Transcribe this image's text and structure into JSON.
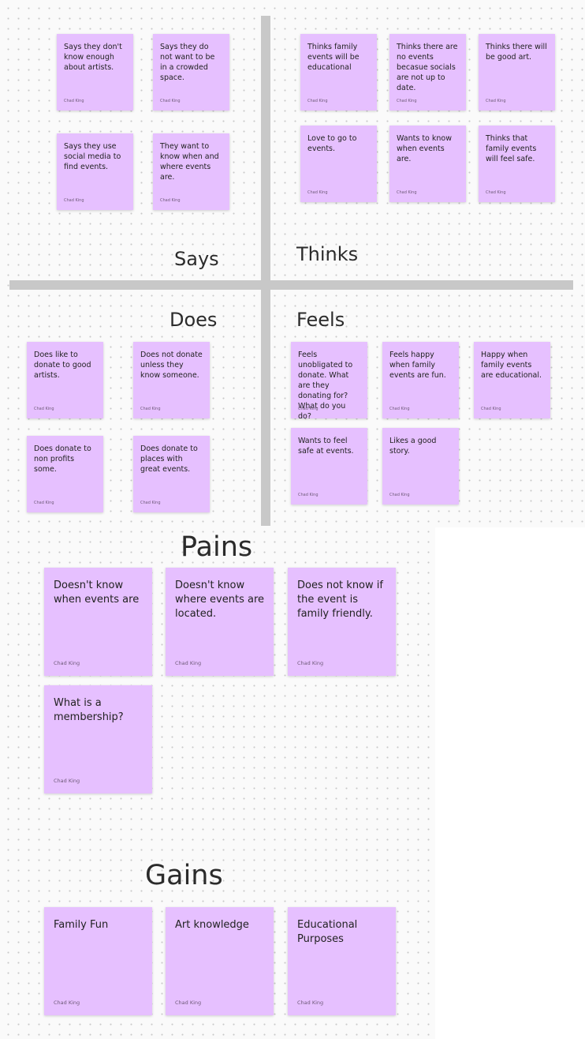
{
  "empathy_map": {
    "says": {
      "label": "Says",
      "notes": [
        {
          "text": "Says they don't know enough about artists.",
          "author": "Chad King"
        },
        {
          "text": "Says they do not want to be in a crowded space.",
          "author": "Chad King"
        },
        {
          "text": "Says they use social media to find events.",
          "author": "Chad King"
        },
        {
          "text": "They want to know when and where events are.",
          "author": "Chad King"
        }
      ]
    },
    "thinks": {
      "label": "Thinks",
      "notes": [
        {
          "text": "Thinks family events will be educational",
          "author": "Chad King"
        },
        {
          "text": "Thinks there are no events becasue socials are not up to date.",
          "author": "Chad King"
        },
        {
          "text": "Thinks there will be good art.",
          "author": "Chad King"
        },
        {
          "text": "Love to go to events.",
          "author": "Chad King"
        },
        {
          "text": "Wants to know when events are.",
          "author": "Chad King"
        },
        {
          "text": "Thinks that family events will feel safe.",
          "author": "Chad King"
        }
      ]
    },
    "does": {
      "label": "Does",
      "notes": [
        {
          "text": "Does like to donate to good artists.",
          "author": "Chad King"
        },
        {
          "text": "Does not donate unless they know someone.",
          "author": "Chad King"
        },
        {
          "text": "Does donate to non profits some.",
          "author": "Chad King"
        },
        {
          "text": "Does donate to places with great events.",
          "author": "Chad King"
        }
      ]
    },
    "feels": {
      "label": "Feels",
      "notes": [
        {
          "text": "Feels unobligated to donate. What are they donating for? What do you do?",
          "author": "Chad King"
        },
        {
          "text": "Feels happy when family events are fun.",
          "author": "Chad King"
        },
        {
          "text": "Happy when family events are educational.",
          "author": "Chad King"
        },
        {
          "text": "Wants to feel safe at events.",
          "author": "Chad King"
        },
        {
          "text": "Likes a good story.",
          "author": "Chad King"
        }
      ]
    }
  },
  "pains": {
    "label": "Pains",
    "notes": [
      {
        "text": "Doesn't know when events are",
        "author": "Chad King"
      },
      {
        "text": "Doesn't know where events are located.",
        "author": "Chad King"
      },
      {
        "text": "Does not know if the event is family friendly.",
        "author": "Chad King"
      },
      {
        "text": "What is a membership?",
        "author": "Chad King"
      }
    ]
  },
  "gains": {
    "label": "Gains",
    "notes": [
      {
        "text": "Family Fun",
        "author": "Chad King"
      },
      {
        "text": "Art knowledge",
        "author": "Chad King"
      },
      {
        "text": "Educational Purposes",
        "author": "Chad King"
      }
    ]
  },
  "colors": {
    "sticky_note": "#e6c0ff",
    "divider": "#c8c8c8",
    "canvas": "#fafafa"
  }
}
